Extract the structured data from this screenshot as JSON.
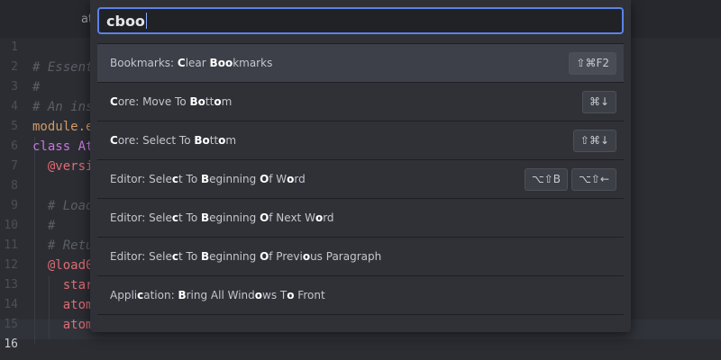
{
  "window": {
    "tab_title": "at"
  },
  "editor": {
    "line_numbers": [
      "1",
      "2",
      "3",
      "4",
      "5",
      "6",
      "7",
      "8",
      "9",
      "10",
      "11",
      "12",
      "13",
      "14",
      "15",
      "16"
    ],
    "code_lines": [
      {
        "text": "",
        "class": "c-plain"
      },
      {
        "text": "# Essent",
        "class": "c-comment"
      },
      {
        "text": "#",
        "class": "c-comment"
      },
      {
        "text": "# An ins",
        "class": "c-comment"
      },
      {
        "text": "module.e",
        "class": "c-plain"
      },
      {
        "text": "class At",
        "class": "c-keyword"
      },
      {
        "text": "  @versi",
        "class": "c-ivar"
      },
      {
        "text": "",
        "class": "c-plain"
      },
      {
        "text": "  # Load",
        "class": "c-comment"
      },
      {
        "text": "  #",
        "class": "c-comment"
      },
      {
        "text": "  # Retu",
        "class": "c-comment"
      },
      {
        "text": "  @load0",
        "class": "c-ivar"
      },
      {
        "text": "    star",
        "class": "c-ivar"
      },
      {
        "text": "    atom",
        "class": "c-ivar"
      },
      {
        "text": "    atom",
        "class": "c-ivar"
      },
      {
        "text": "",
        "class": "c-plain"
      }
    ],
    "current_line": "16"
  },
  "palette": {
    "query": "cboo",
    "items": [
      {
        "label_parts": [
          [
            "Bookmarks: ",
            false
          ],
          [
            "C",
            true
          ],
          [
            "lear ",
            false
          ],
          [
            "Boo",
            true
          ],
          [
            "kmarks",
            false
          ]
        ],
        "shortcuts": [
          "⇧⌘F2"
        ],
        "selected": true
      },
      {
        "label_parts": [
          [
            "C",
            true
          ],
          [
            "ore: Move To ",
            false
          ],
          [
            "Bo",
            true
          ],
          [
            "tt",
            false
          ],
          [
            "o",
            true
          ],
          [
            "m",
            false
          ]
        ],
        "shortcuts": [
          "⌘↓"
        ],
        "selected": false
      },
      {
        "label_parts": [
          [
            "C",
            true
          ],
          [
            "ore: Select To ",
            false
          ],
          [
            "Bo",
            true
          ],
          [
            "tt",
            false
          ],
          [
            "o",
            true
          ],
          [
            "m",
            false
          ]
        ],
        "shortcuts": [
          "⇧⌘↓"
        ],
        "selected": false
      },
      {
        "label_parts": [
          [
            "Editor: Sele",
            false
          ],
          [
            "c",
            true
          ],
          [
            "t To ",
            false
          ],
          [
            "B",
            true
          ],
          [
            "eginning ",
            false
          ],
          [
            "O",
            true
          ],
          [
            "f W",
            false
          ],
          [
            "o",
            true
          ],
          [
            "rd",
            false
          ]
        ],
        "shortcuts": [
          "⌥⇧B",
          "⌥⇧←"
        ],
        "selected": false
      },
      {
        "label_parts": [
          [
            "Editor: Sele",
            false
          ],
          [
            "c",
            true
          ],
          [
            "t To ",
            false
          ],
          [
            "B",
            true
          ],
          [
            "eginning ",
            false
          ],
          [
            "O",
            true
          ],
          [
            "f Next W",
            false
          ],
          [
            "o",
            true
          ],
          [
            "rd",
            false
          ]
        ],
        "shortcuts": [],
        "selected": false
      },
      {
        "label_parts": [
          [
            "Editor: Sele",
            false
          ],
          [
            "c",
            true
          ],
          [
            "t To ",
            false
          ],
          [
            "B",
            true
          ],
          [
            "eginning ",
            false
          ],
          [
            "O",
            true
          ],
          [
            "f Previ",
            false
          ],
          [
            "o",
            true
          ],
          [
            "us Paragraph",
            false
          ]
        ],
        "shortcuts": [],
        "selected": false
      },
      {
        "label_parts": [
          [
            "Appli",
            false
          ],
          [
            "c",
            true
          ],
          [
            "ation: ",
            false
          ],
          [
            "B",
            true
          ],
          [
            "ring All Wind",
            false
          ],
          [
            "o",
            true
          ],
          [
            "ws T",
            false
          ],
          [
            "o",
            true
          ],
          [
            " Front",
            false
          ]
        ],
        "shortcuts": [],
        "selected": false
      }
    ]
  },
  "colors": {
    "accent": "#5c82e8",
    "selected_row": "#3d4048",
    "palette_bg": "#2f3137"
  }
}
